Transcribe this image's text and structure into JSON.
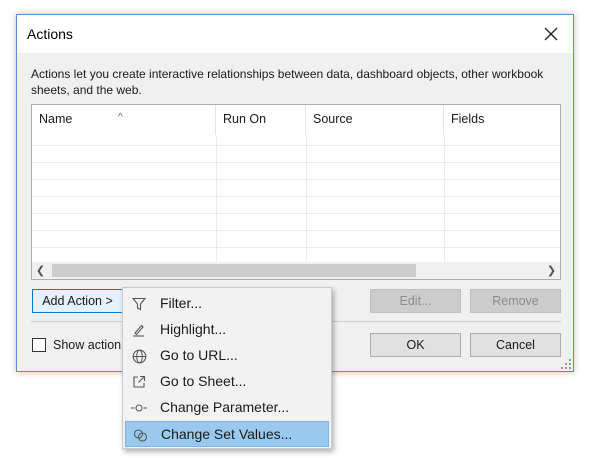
{
  "dialog": {
    "title": "Actions",
    "description": "Actions let you create interactive relationships between data, dashboard objects, other workbook sheets, and the web."
  },
  "table": {
    "columns": [
      "Name",
      "Run On",
      "Source",
      "Fields"
    ],
    "rows": []
  },
  "buttons": {
    "add_action": "Add Action >",
    "edit": "Edit...",
    "remove": "Remove",
    "ok": "OK",
    "cancel": "Cancel"
  },
  "checkbox": {
    "label": "Show action",
    "checked": false
  },
  "menu": {
    "items": [
      {
        "label": "Filter...",
        "icon": "filter-icon"
      },
      {
        "label": "Highlight...",
        "icon": "highlight-pen-icon"
      },
      {
        "label": "Go to URL...",
        "icon": "globe-icon"
      },
      {
        "label": "Go to Sheet...",
        "icon": "external-sheet-icon"
      },
      {
        "label": "Change Parameter...",
        "icon": "parameter-icon"
      },
      {
        "label": "Change Set Values...",
        "icon": "set-icon",
        "highlighted": true
      }
    ]
  },
  "colors": {
    "dialog_bg": "#f0f0f0",
    "accent": "#0078d7",
    "menu_highlight": "#99c9ef"
  }
}
